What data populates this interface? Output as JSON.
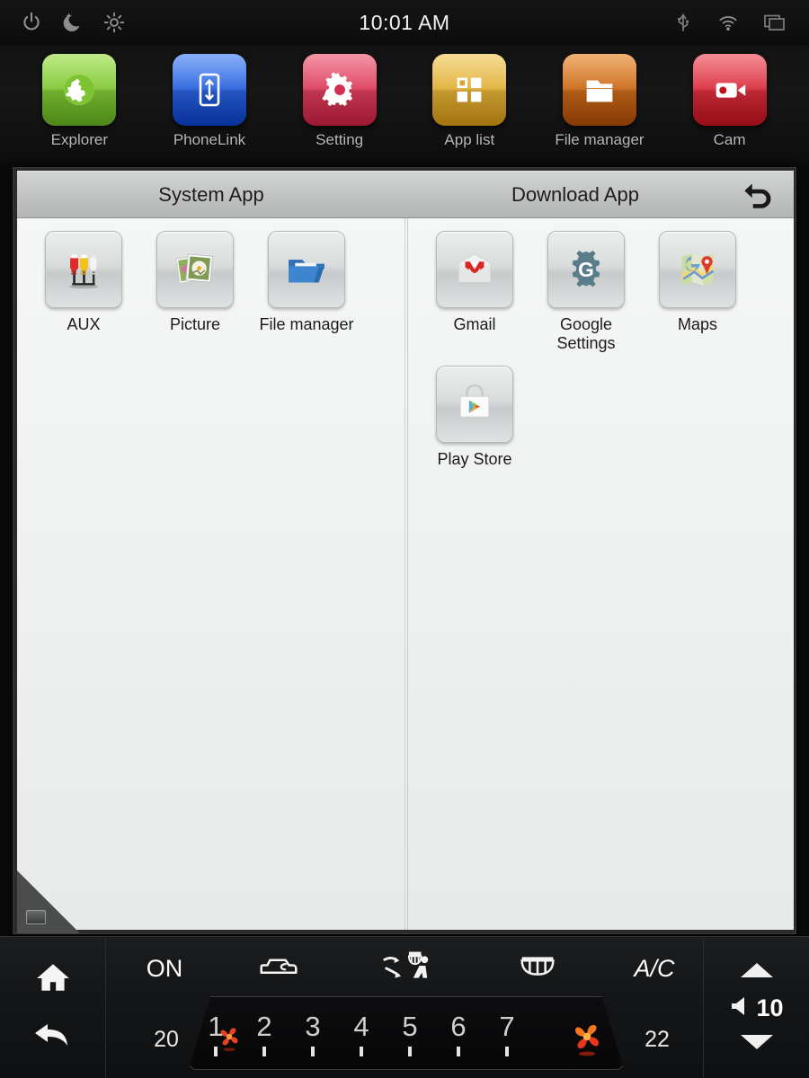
{
  "status_bar": {
    "clock": "10:01 AM",
    "left_icons": [
      {
        "name": "power-icon",
        "label": "Power"
      },
      {
        "name": "night-mode-icon",
        "label": "Night mode"
      },
      {
        "name": "brightness-icon",
        "label": "Brightness"
      }
    ],
    "right_icons": [
      {
        "name": "usb-icon",
        "label": "USB"
      },
      {
        "name": "wifi-icon",
        "label": "Wi-Fi"
      },
      {
        "name": "recent-apps-icon",
        "label": "Recent apps"
      }
    ]
  },
  "shortcut_dock": {
    "items": [
      {
        "label": "Explorer",
        "icon": "globe-icon",
        "color": "#7cc432"
      },
      {
        "label": "PhoneLink",
        "icon": "phone-link-icon",
        "color": "#1f5fe0"
      },
      {
        "label": "Setting",
        "icon": "gear-icon",
        "color": "#e03a5a"
      },
      {
        "label": "App list",
        "icon": "grid-icon",
        "color": "#e0a92a"
      },
      {
        "label": "File manager",
        "icon": "folder-icon",
        "color": "#d4660f"
      },
      {
        "label": "Cam",
        "icon": "camcorder-icon",
        "color": "#e02030"
      }
    ]
  },
  "app_window": {
    "tab_system_label": "System App",
    "tab_download_label": "Download App",
    "back_icon": "back-arrow-icon",
    "system_apps": [
      {
        "label": "AUX",
        "icon": "rca-cables-icon"
      },
      {
        "label": "Picture",
        "icon": "photo-icon"
      },
      {
        "label": "File manager",
        "icon": "blue-folder-icon"
      }
    ],
    "download_apps": [
      {
        "label": "Gmail",
        "icon": "gmail-icon"
      },
      {
        "label": "Google Settings",
        "icon": "google-settings-icon"
      },
      {
        "label": "Maps",
        "icon": "maps-icon"
      },
      {
        "label": "Play Store",
        "icon": "play-store-icon"
      }
    ]
  },
  "climate_bar": {
    "nav": [
      {
        "name": "home-button",
        "icon": "home-icon"
      },
      {
        "name": "back-button",
        "icon": "back-arrow-icon"
      }
    ],
    "power_label": "ON",
    "ac_label": "A/C",
    "recirculation_icon": "car-recirculation-icon",
    "airflow_icon": "airflow-seat-icon",
    "defrost_icon": "rear-defrost-icon",
    "temp_left": "20",
    "temp_right": "22",
    "fan_steps": [
      "1",
      "2",
      "3",
      "4",
      "5",
      "6",
      "7"
    ],
    "fan_low_icon": "fan-low-icon",
    "fan_high_icon": "fan-high-icon",
    "volume": {
      "up_icon": "volume-up-icon",
      "down_icon": "volume-down-icon",
      "speaker_icon": "speaker-icon",
      "level": "10"
    }
  },
  "colors": {
    "accent_orange": "#ff6a1a",
    "panel_light": "#eef0f0",
    "header_gray": "#c2c4c4",
    "bar_dark": "#141618"
  }
}
